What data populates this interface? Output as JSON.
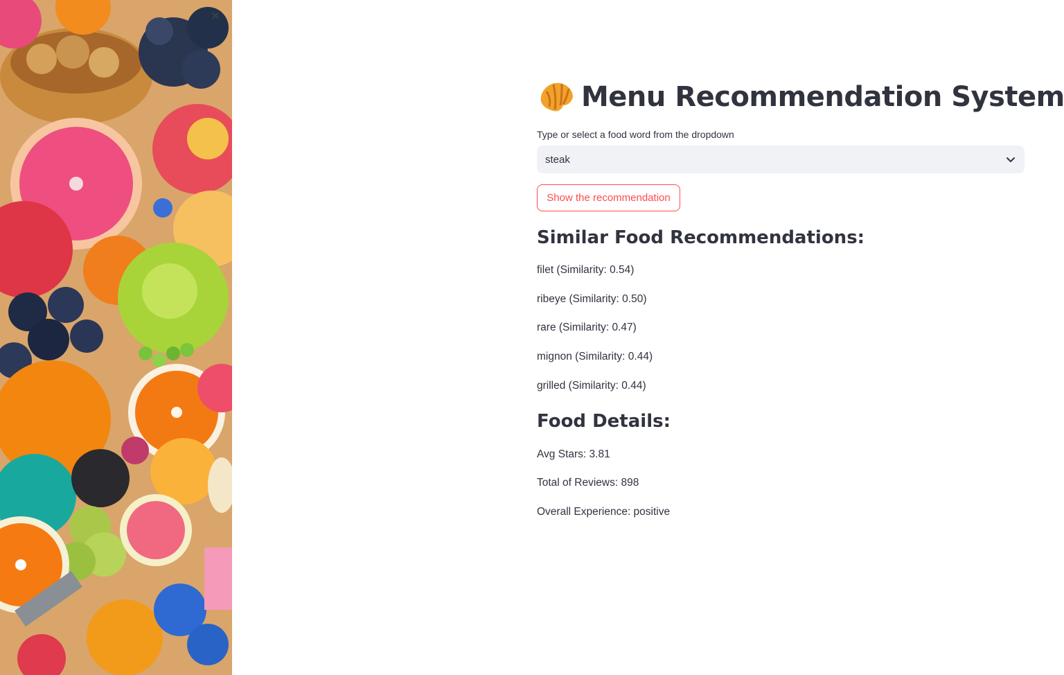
{
  "sidebar": {
    "close_icon": "close-icon",
    "close_glyph": "×",
    "background_image": "colorful fruit illustration"
  },
  "app": {
    "title_emoji": "croissant-icon",
    "title": "Menu Recommendation System"
  },
  "selector": {
    "label": "Type or select a food word from the dropdown",
    "value": "steak",
    "icon": "chevron-down-icon"
  },
  "button": {
    "label": "Show the recommendation",
    "accent": "#ff4b4b"
  },
  "recommendations": {
    "heading": "Similar Food Recommendations:",
    "items": [
      "filet (Similarity: 0.54)",
      "ribeye (Similarity: 0.50)",
      "rare (Similarity: 0.47)",
      "mignon (Similarity: 0.44)",
      "grilled (Similarity: 0.44)"
    ]
  },
  "details": {
    "heading": "Food Details:",
    "avg_stars": "Avg Stars: 3.81",
    "total_reviews": "Total of Reviews: 898",
    "overall_experience": "Overall Experience: positive"
  }
}
